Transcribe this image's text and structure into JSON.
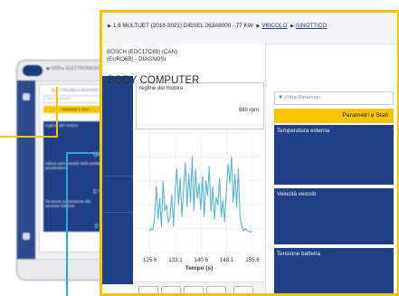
{
  "background_device": {
    "breadcrumb": "◆ 0305 ▸ ELETTRONICA MOTORE",
    "panel_title": "ELETTRONICA MOTORE",
    "search_placeholder": "Filtra Parametri",
    "tab_label": "Parametri e Stati",
    "blocks": [
      {
        "label": "regime del motore",
        "value": "rpm"
      },
      {
        "label": "Valore percentuale della pedale acceleratore",
        "value": "0 %"
      },
      {
        "label": "Tensione proveniente dal sensore batteria",
        "value": "0 V"
      }
    ]
  },
  "breadcrumb": {
    "vehicle": "1.6 MULTIJET (2018-2021) DIESEL 263A8000 - 77 KW",
    "link_vehicle": "VEICOLO",
    "link_synoptic": "SINOTTICO"
  },
  "ecu_panel": {
    "title": "BOSCH (EDC17C69) (CAN) (EURO6B) - DIAGNOSI",
    "parameter_name": "regime del motore",
    "parameter_value": "880 rpm"
  },
  "chart_data": {
    "type": "line",
    "x_ticks": [
      "125.6",
      "133.1",
      "140.6",
      "148.1",
      "155.6"
    ],
    "xlabel": "Tempo (s)",
    "xlim": [
      122,
      158
    ],
    "ylim": [
      0,
      100
    ],
    "series": [
      {
        "x": [
          125.5,
          126.0,
          126.5,
          127.0,
          127.5,
          128.0,
          128.5,
          129.0,
          129.5,
          130.0,
          130.5,
          131.0,
          131.5,
          132.0,
          132.5,
          133.0,
          133.5,
          134.0,
          134.5,
          135.0,
          135.5,
          136.0,
          136.5,
          137.0,
          137.5,
          138.0,
          138.5,
          139.0,
          139.5,
          140.0,
          140.5,
          141.0,
          141.5,
          142.0,
          142.5,
          143.0,
          143.5,
          144.0,
          144.5,
          145.0,
          145.5,
          146.0,
          146.5,
          147.0,
          147.5,
          148.0,
          148.5,
          149.0,
          149.5,
          150.0,
          150.5,
          151.0,
          151.5,
          152.0,
          152.5,
          153.0,
          153.5,
          154.0,
          154.5,
          155.0,
          155.5
        ],
        "values": [
          18,
          20,
          19,
          30,
          55,
          28,
          45,
          22,
          60,
          35,
          40,
          25,
          30,
          48,
          22,
          52,
          70,
          40,
          62,
          30,
          55,
          75,
          38,
          66,
          42,
          80,
          35,
          70,
          45,
          58,
          36,
          64,
          30,
          60,
          48,
          72,
          34,
          55,
          28,
          46,
          40,
          62,
          30,
          44,
          26,
          52,
          74,
          58,
          80,
          42,
          66,
          38,
          70,
          30,
          22,
          18,
          20,
          19,
          18,
          17,
          18
        ]
      }
    ],
    "grid": true,
    "line_color": "#5ab4d9"
  },
  "body_computer": {
    "title": "BODY COMPUTER",
    "filter_placeholder": "Filtra Parametri",
    "tab_label": "Parametri e Stati",
    "tiles": [
      {
        "label": "Temperatura esterna"
      },
      {
        "label": "Velocità veicolo"
      },
      {
        "label": "Tensione batteria"
      }
    ]
  },
  "colors": {
    "accent_yellow": "#f6c400",
    "navy": "#1f3f86",
    "callout_blue": "#2aa7e0"
  }
}
